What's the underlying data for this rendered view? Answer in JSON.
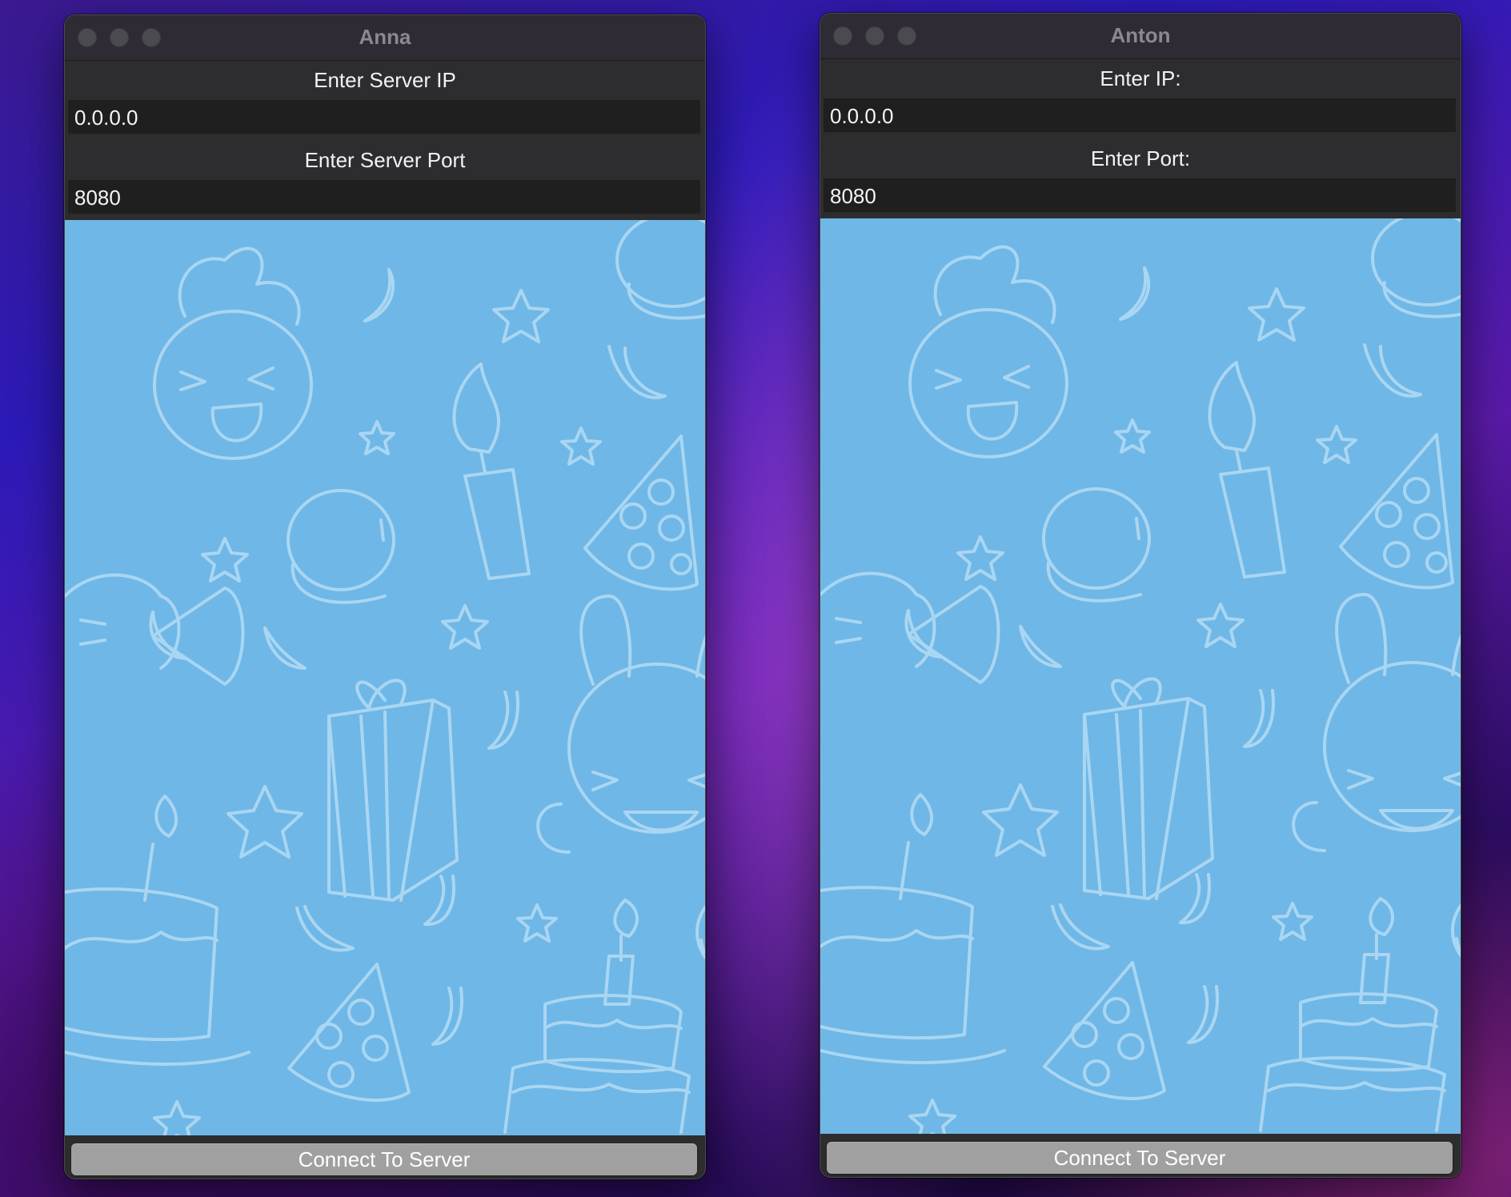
{
  "windows": [
    {
      "title": "Anna",
      "ip_label": "Enter Server IP",
      "ip_value": "0.0.0.0",
      "port_label": "Enter Server Port",
      "port_value": "8080",
      "connect_label": "Connect To Server"
    },
    {
      "title": "Anton",
      "ip_label": "Enter IP:",
      "ip_value": "0.0.0.0",
      "port_label": "Enter Port:",
      "port_value": "8080",
      "connect_label": "Connect To Server"
    }
  ],
  "colors": {
    "wallpaper": "#6fb7e6",
    "doodle_stroke": "#a9d6f2",
    "window": "#2d2d2f",
    "input": "#1f1f1f",
    "button": "#a0a0a0"
  }
}
